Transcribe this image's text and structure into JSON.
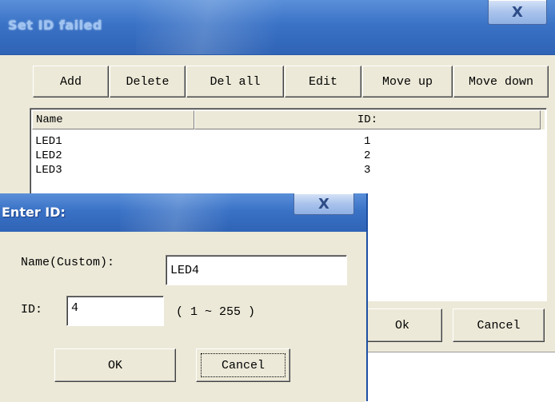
{
  "main_window": {
    "title": "Set ID failed",
    "close_glyph": "X",
    "toolbar": {
      "add": "Add",
      "delete": "Delete",
      "del_all": "Del all",
      "edit": "Edit",
      "move_up": "Move up",
      "move_down": "Move down"
    },
    "list": {
      "columns": [
        "Name",
        "ID:"
      ],
      "rows": [
        {
          "name": "LED1",
          "id": "1"
        },
        {
          "name": "LED2",
          "id": "2"
        },
        {
          "name": "LED3",
          "id": "3"
        }
      ]
    },
    "buttons": {
      "ok": "Ok",
      "cancel": "Cancel"
    }
  },
  "enter_id_dialog": {
    "title": "Enter ID:",
    "close_glyph": "X",
    "name_label": "Name(Custom):",
    "name_value": "LED4",
    "id_label": "ID:",
    "id_value": "4",
    "range_hint": "( 1 ~ 255 )",
    "ok_label": "OK",
    "cancel_label": "Cancel"
  }
}
